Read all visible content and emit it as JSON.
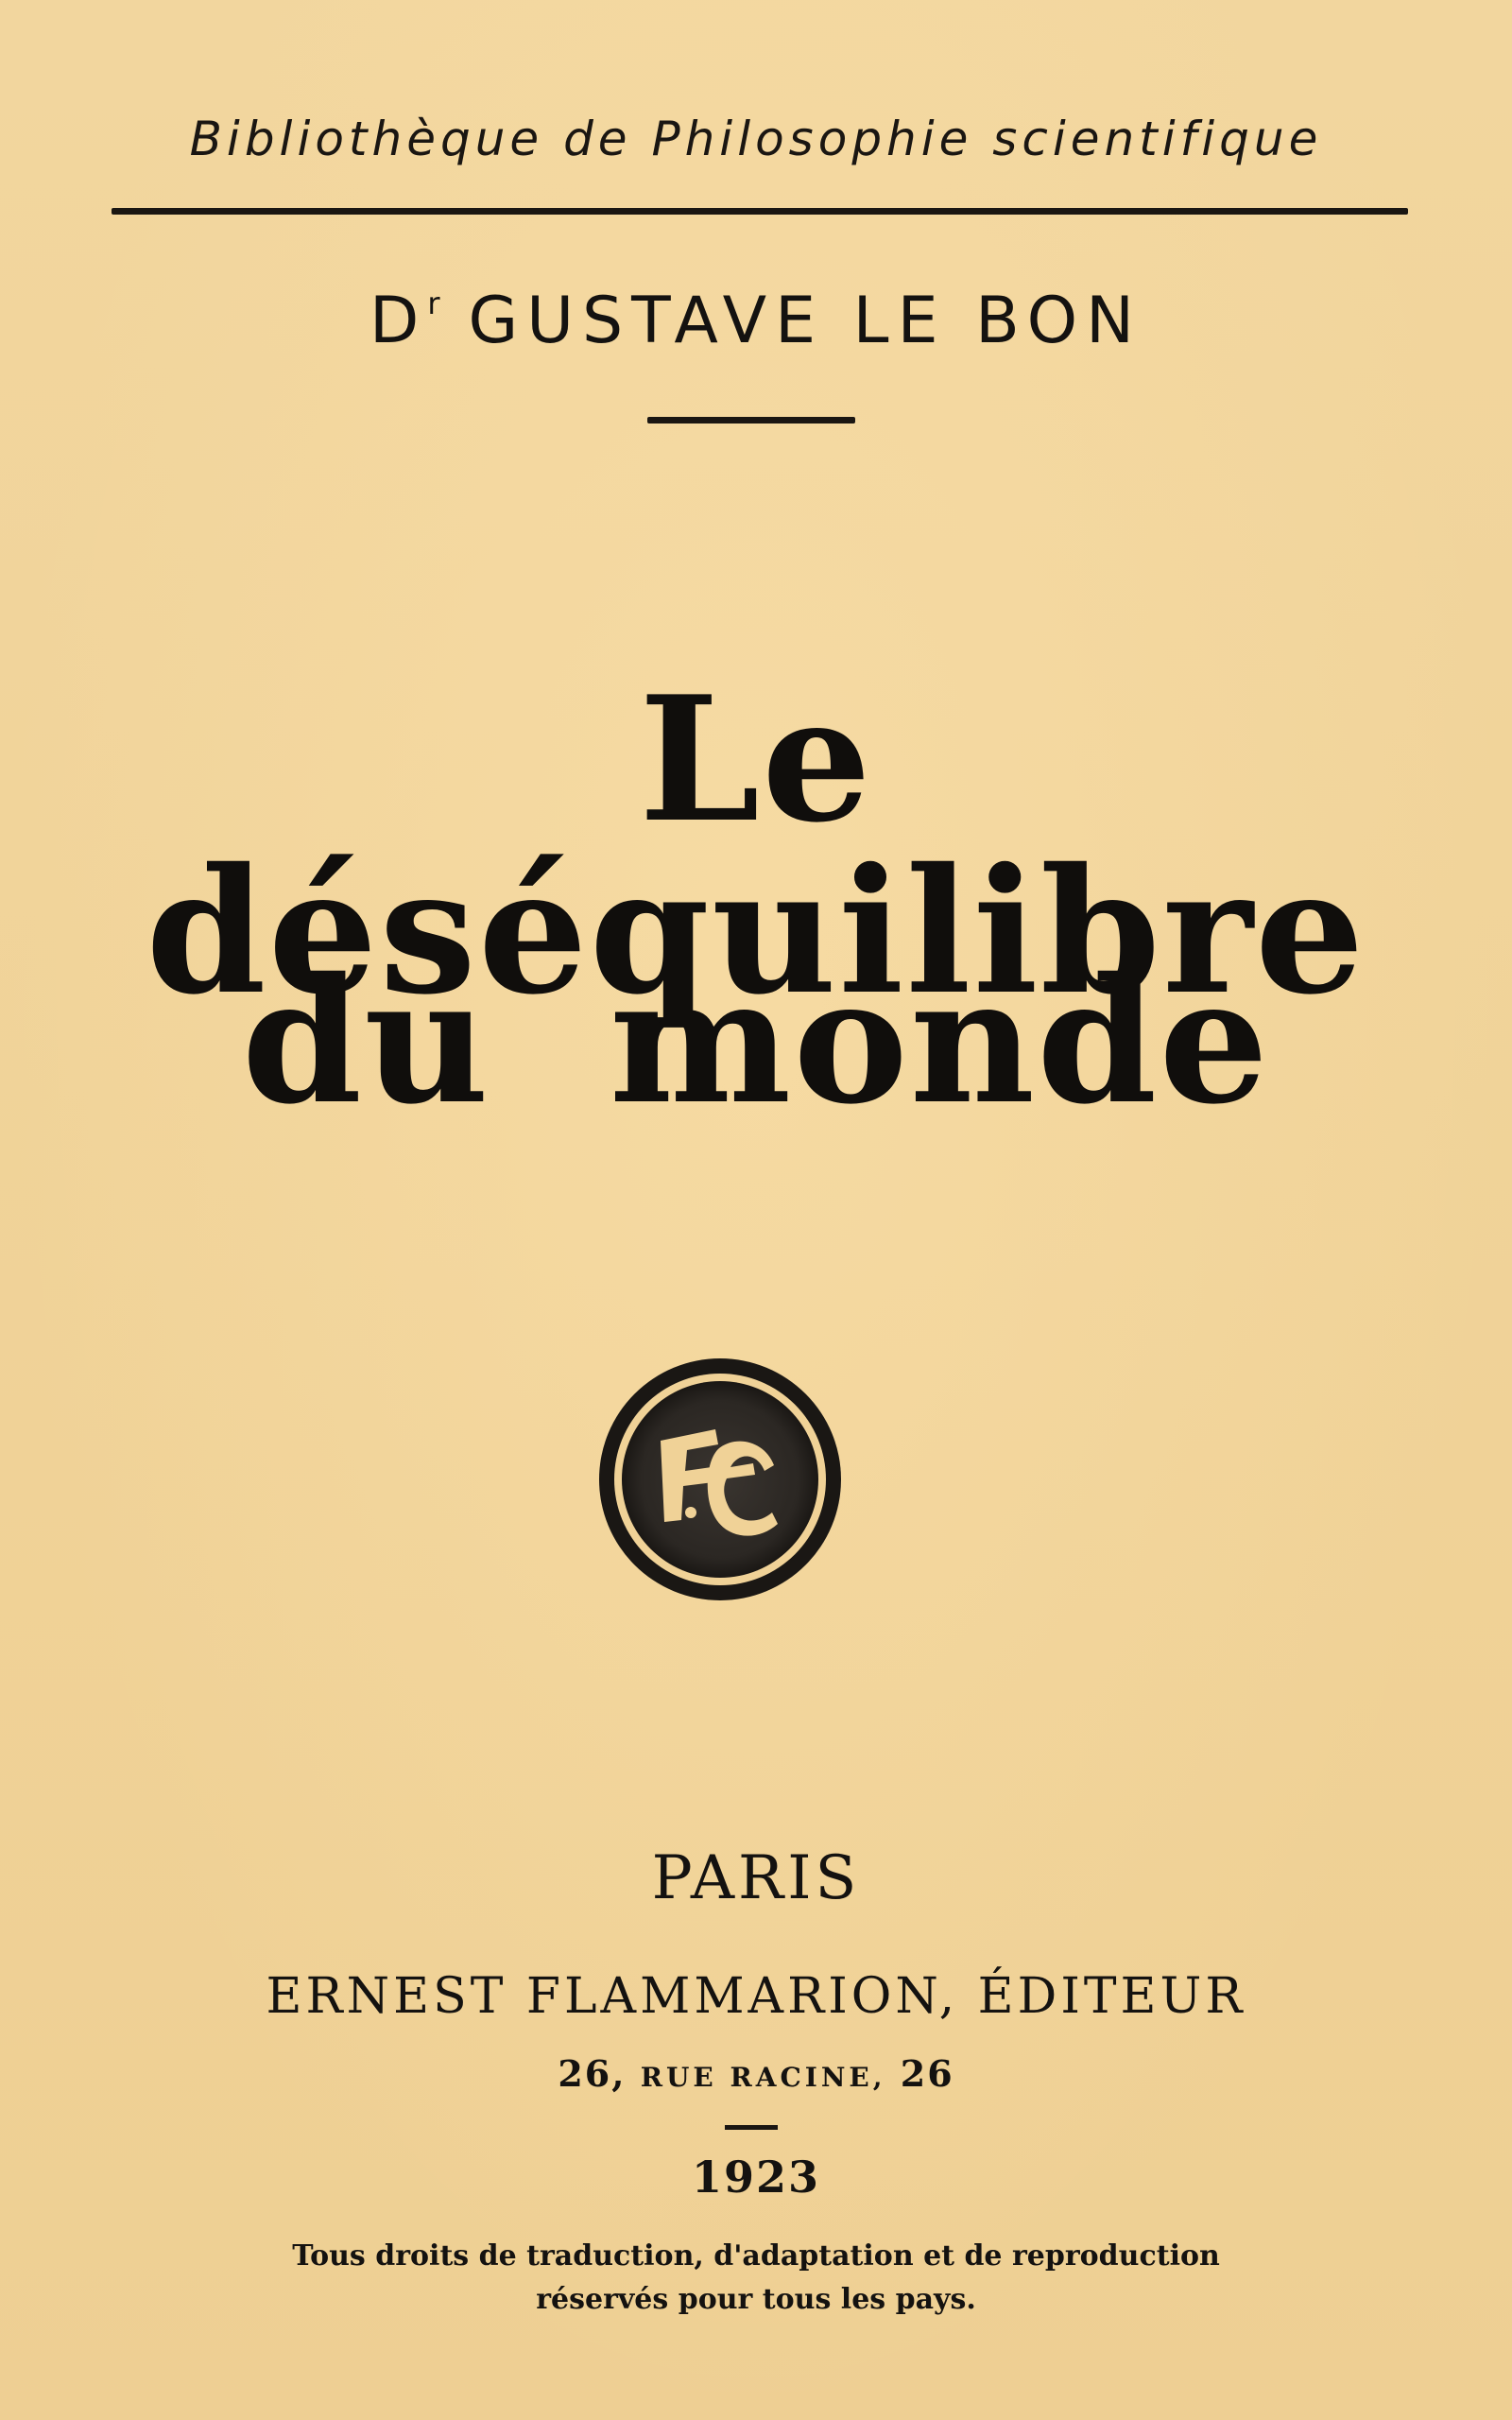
{
  "header": {
    "series": "Bibliothèque de Philosophie scientifique",
    "author_title": "D",
    "author_title_sup": "r",
    "author_name": "GUSTAVE LE BON"
  },
  "title": {
    "line1": "Le déséquilibre",
    "line2": "du monde"
  },
  "seal": {
    "icon": "publisher-monogram-seal",
    "lettering": "EF"
  },
  "imprint": {
    "city": "PARIS",
    "publisher": "ERNEST FLAMMARION, ÉDITEUR",
    "address_number_1": "26,",
    "address_street": "RUE RACINE,",
    "address_number_2": "26",
    "year": "1923",
    "rights_line1": "Tous droits de traduction, d'adaptation et de reproduction",
    "rights_line2": "réservés pour tous les pays."
  },
  "colors": {
    "paper": "#f1d49a",
    "ink": "#141210"
  }
}
